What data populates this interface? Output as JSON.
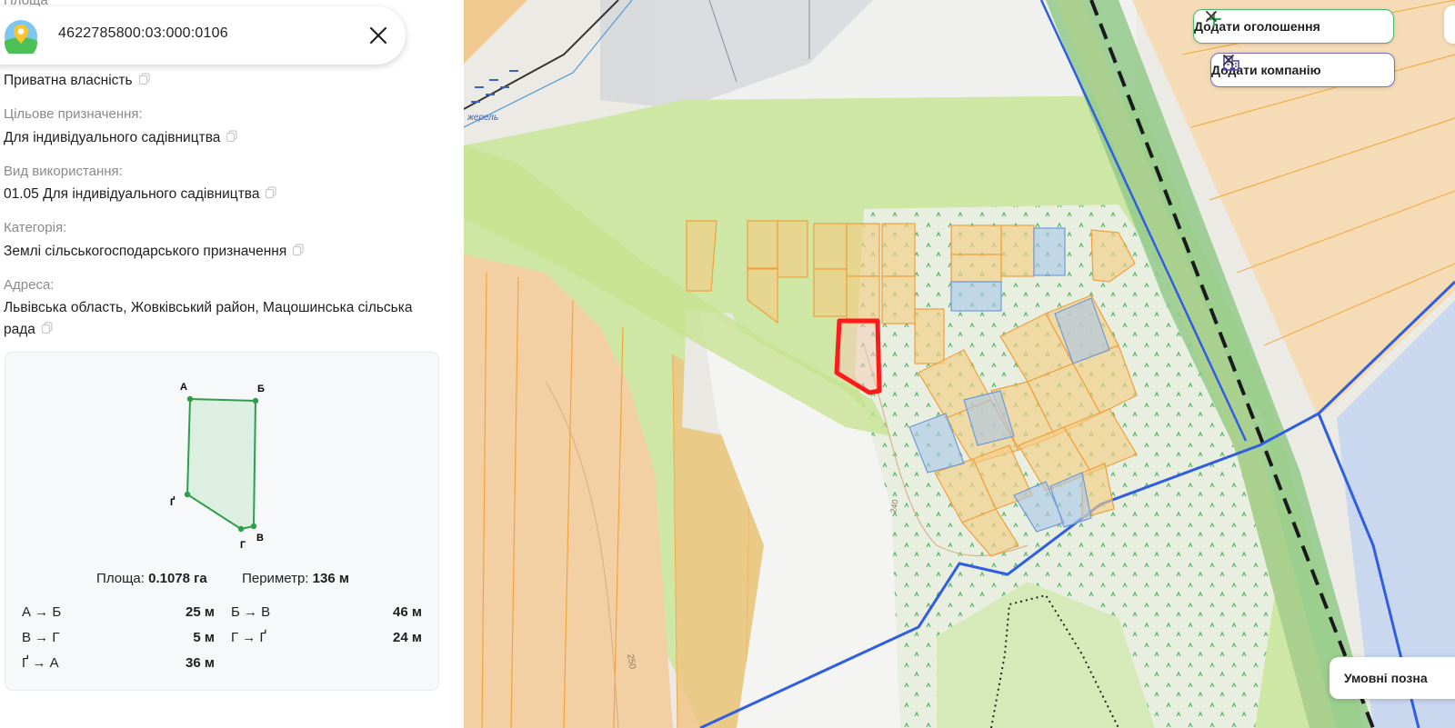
{
  "panel": {
    "cut_label": "Площа",
    "cadastral_number": "4622785800:03:000:0106",
    "ownership_value": "Приватна власність",
    "purpose_label": "Цільове призначення:",
    "purpose_value": "Для індивідуального садівництва",
    "usage_label": "Вид використання:",
    "usage_value": "01.05 Для індивідуального садівництва",
    "category_label": "Категорія:",
    "category_value": "Землі сільськогосподарського призначення",
    "address_label": "Адреса:",
    "address_value": "Львівська область, Жовківський район, Мацошинська сільська рада"
  },
  "geometry": {
    "vertices": [
      "А",
      "Б",
      "В",
      "Г",
      "Ґ"
    ],
    "area_label": "Площа:",
    "area_value": "0.1078 га",
    "perimeter_label": "Периметр:",
    "perimeter_value": "136 м",
    "edges": [
      {
        "label": "А → Б",
        "value": "25 м"
      },
      {
        "label": "Б → В",
        "value": "46 м"
      },
      {
        "label": "В → Г",
        "value": "5 м"
      },
      {
        "label": "Г → Ґ",
        "value": "24 м"
      },
      {
        "label": "Ґ → А",
        "value": "36 м"
      }
    ]
  },
  "map": {
    "add_listing_label": "Додати оголошення",
    "add_company_label": "Додати компанію",
    "smart_search_label": "Умовні позна",
    "river_label": "жерель",
    "contour_240": "240",
    "contour_250": "250"
  },
  "colors": {
    "parcel_highlight": "#ff1a1a",
    "boundary_line": "#2f5ee0",
    "green_button_border": "#4cbb6c",
    "purple_button_border": "#7a6ad0",
    "shape_stroke": "#2e9e4a"
  },
  "icons": [
    "search-logo-icon",
    "close-icon",
    "copy-icon",
    "plus-icon",
    "building-icon"
  ]
}
